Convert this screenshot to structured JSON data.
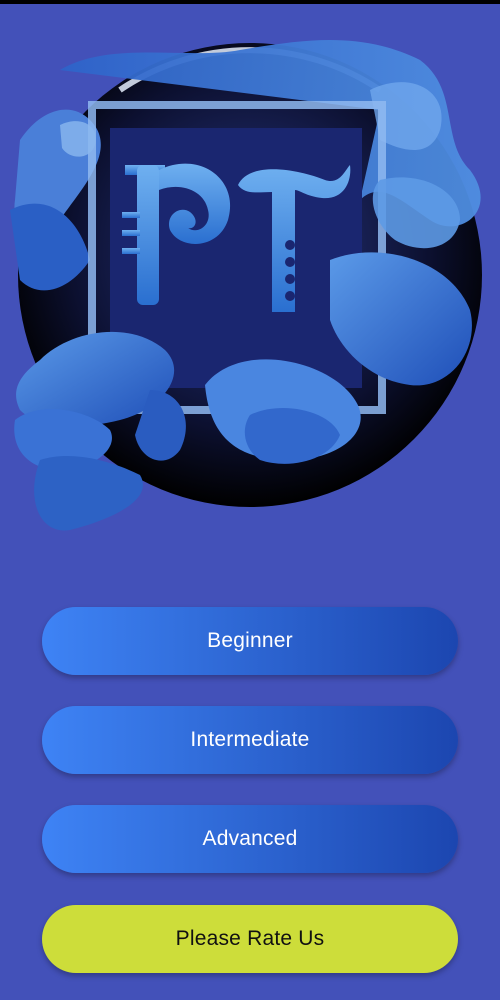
{
  "logo": {
    "letters": "PT",
    "icon": "pt-splash-logo"
  },
  "menu": {
    "beginner_label": "Beginner",
    "intermediate_label": "Intermediate",
    "advanced_label": "Advanced",
    "rate_label": "Please Rate Us"
  },
  "colors": {
    "background": "#4351b9",
    "button_gradient_start": "#3e83f5",
    "button_gradient_end": "#1c46b0",
    "rate_button": "#cddd3a"
  }
}
